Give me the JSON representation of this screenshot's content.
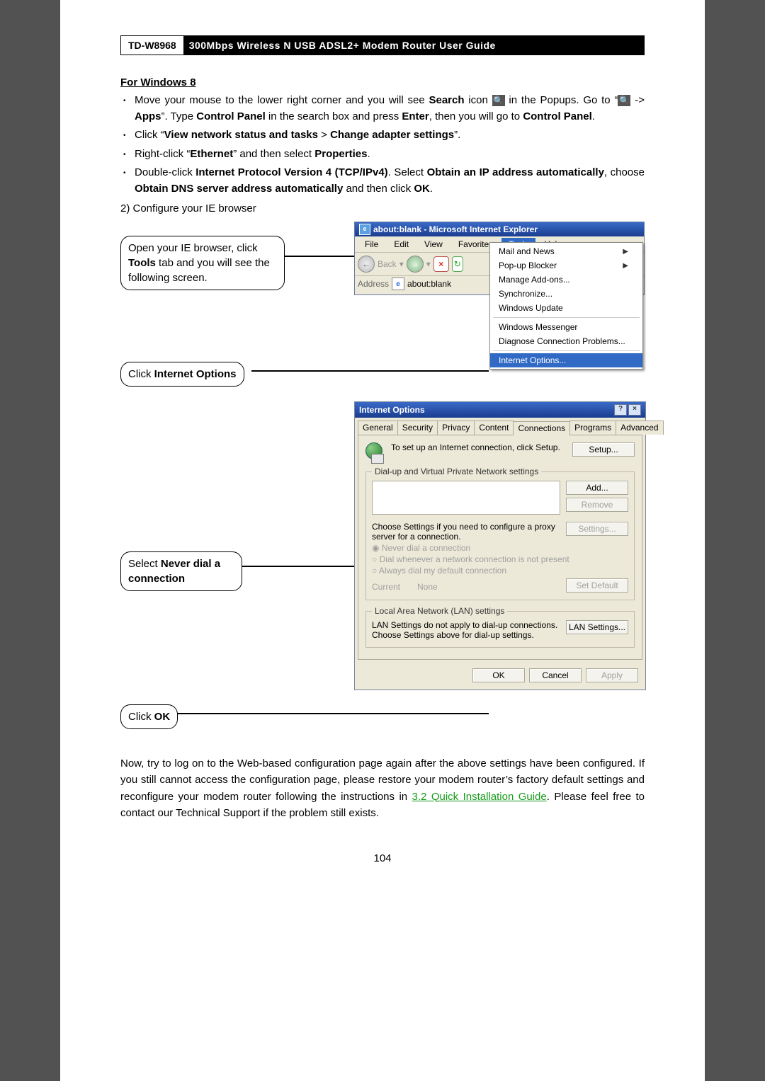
{
  "header": {
    "model": "TD-W8968",
    "title": "300Mbps Wireless N USB ADSL2+ Modem Router User Guide"
  },
  "win8": {
    "heading": "For Windows 8",
    "b1_a": "Move your mouse to the lower right corner and you will see ",
    "b1_search": "Search",
    "b1_b": " icon ",
    "b1_c": " in the Popups. Go to “",
    "b1_d": " -> ",
    "b1_apps": "Apps",
    "b1_e": "”. Type ",
    "b1_cp": "Control Panel",
    "b1_f": " in the search box and press ",
    "b1_enter": "Enter",
    "b1_g": ", then you will go to ",
    "b1_cp2": "Control Panel",
    "b2_a": "Click “",
    "b2_v": "View network status and tasks",
    "b2_b": " > ",
    "b2_c": "Change adapter settings",
    "b2_d": "”.",
    "b3_a": "Right-click “",
    "b3_eth": "Ethernet",
    "b3_b": "” and then select ",
    "b3_prop": "Properties",
    "b4_a": "Double-click ",
    "b4_ipv4": "Internet Protocol Version 4 (TCP/IPv4)",
    "b4_b": ". Select ",
    "b4_obip": "Obtain an IP address automatically",
    "b4_c": ", choose ",
    "b4_obdns": "Obtain DNS server address automatically",
    "b4_d": " and then click ",
    "b4_ok": "OK"
  },
  "step2": "2)  Configure your IE browser",
  "callouts": {
    "c1a": "Open your IE browser, click ",
    "c1b": "Tools",
    "c1c": " tab and you will see the following screen.",
    "c2a": "Click ",
    "c2b": "Internet Options",
    "c3a": "Select ",
    "c3b": "Never dial a connection",
    "c4a": "Click ",
    "c4b": "OK"
  },
  "ie": {
    "title": "about:blank - Microsoft Internet Explorer",
    "menus": [
      "File",
      "Edit",
      "View",
      "Favorites",
      "Tools",
      "Help"
    ],
    "back": "Back",
    "addrLabel": "Address",
    "addrValue": "about:blank",
    "sub": {
      "mail": "Mail and News",
      "popup": "Pop-up Blocker",
      "addons": "Manage Add-ons...",
      "sync": "Synchronize...",
      "wu": "Windows Update",
      "wm": "Windows Messenger",
      "diag": "Diagnose Connection Problems...",
      "io": "Internet Options..."
    }
  },
  "io": {
    "title": "Internet Options",
    "tabs": [
      "General",
      "Security",
      "Privacy",
      "Content",
      "Connections",
      "Programs",
      "Advanced"
    ],
    "setupText": "To set up an Internet connection, click Setup.",
    "setupBtn": "Setup...",
    "fsDial": "Dial-up and Virtual Private Network settings",
    "addBtn": "Add...",
    "removeBtn": "Remove",
    "proxyText": "Choose Settings if you need to configure a proxy server for a connection.",
    "settingsBtn": "Settings...",
    "r1": "Never dial a connection",
    "r2": "Dial whenever a network connection is not present",
    "r3": "Always dial my default connection",
    "currentLabel": "Current",
    "currentValue": "None",
    "setDefault": "Set Default",
    "fsLan": "Local Area Network (LAN) settings",
    "lanText": "LAN Settings do not apply to dial-up connections. Choose Settings above for dial-up settings.",
    "lanBtn": "LAN Settings...",
    "ok": "OK",
    "cancel": "Cancel",
    "apply": "Apply"
  },
  "closing": {
    "a": "Now, try to log on to the Web-based configuration page again after the above settings have been configured. If you still cannot access the configuration page, please restore your modem router’s factory default settings and reconfigure your modem router following the instructions in ",
    "link": "3.2 Quick Installation Guide",
    "b": ". Please feel free to contact our Technical Support if the problem still exists."
  },
  "pageNumber": "104"
}
